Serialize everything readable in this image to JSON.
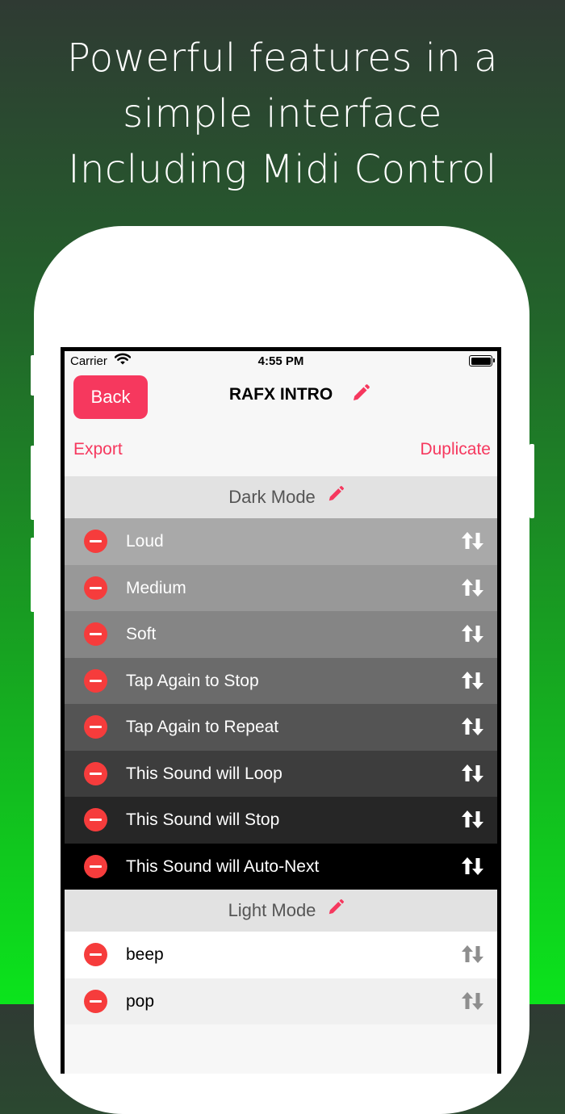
{
  "headline": {
    "line1": "Powerful features in a",
    "line2": "simple interface",
    "line3": "Including Midi Control"
  },
  "status_bar": {
    "carrier": "Carrier",
    "time": "4:55 PM"
  },
  "nav": {
    "back_label": "Back",
    "title": "RAFX INTRO",
    "export_label": "Export",
    "duplicate_label": "Duplicate"
  },
  "colors": {
    "accent": "#f6385e",
    "delete": "#f63c3c"
  },
  "sections": [
    {
      "title": "Dark Mode",
      "rows": [
        {
          "label": "Loud",
          "bg": "#a9a9a9",
          "fg": "#ffffff"
        },
        {
          "label": "Medium",
          "bg": "#989898",
          "fg": "#ffffff"
        },
        {
          "label": "Soft",
          "bg": "#858585",
          "fg": "#ffffff"
        },
        {
          "label": "Tap Again to Stop",
          "bg": "#6b6b6b",
          "fg": "#ffffff"
        },
        {
          "label": "Tap Again to Repeat",
          "bg": "#545454",
          "fg": "#ffffff"
        },
        {
          "label": "This Sound will Loop",
          "bg": "#3d3d3d",
          "fg": "#ffffff"
        },
        {
          "label": "This Sound will Stop",
          "bg": "#262626",
          "fg": "#ffffff"
        },
        {
          "label": "This Sound will Auto-Next",
          "bg": "#000000",
          "fg": "#ffffff"
        }
      ]
    },
    {
      "title": "Light Mode",
      "rows": [
        {
          "label": "beep",
          "bg": "#ffffff",
          "fg": "#000000"
        },
        {
          "label": "pop",
          "bg": "#f0f0f0",
          "fg": "#000000"
        }
      ]
    }
  ],
  "icons": {
    "edit": "pencil-icon",
    "reorder": "reorder-arrows-icon",
    "delete": "minus-circle-icon"
  }
}
